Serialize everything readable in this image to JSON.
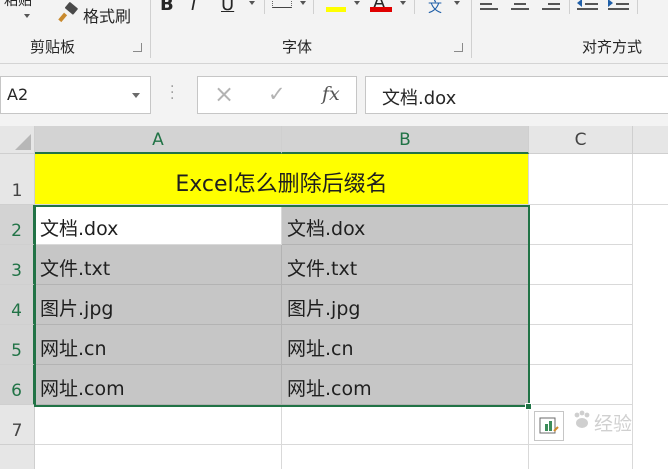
{
  "ribbon": {
    "groups": [
      {
        "label": "剪贴板"
      },
      {
        "label": "字体"
      },
      {
        "label": "对齐方式"
      }
    ],
    "format_painter_label": "格式刷",
    "paste_partial": "粘贴",
    "bold_label": "B",
    "italic_label": "I",
    "underline_label": "U",
    "font_color_letter": "A",
    "wen_label": "文",
    "colors": {
      "highlight": "#ffff00",
      "font_color": "#e00000",
      "accent": "#217346"
    }
  },
  "formula_bar": {
    "name_box": "A2",
    "cancel_icon": "×",
    "enter_icon": "✓",
    "fx_label": "fx",
    "value": "文档.dox"
  },
  "grid": {
    "columns": [
      "A",
      "B",
      "C"
    ],
    "rows": [
      "1",
      "2",
      "3",
      "4",
      "5",
      "6",
      "7"
    ],
    "title": "Excel怎么删除后缀名",
    "data": [
      [
        "文档.dox",
        "文档.dox"
      ],
      [
        "文件.txt",
        "文件.txt"
      ],
      [
        "图片.jpg",
        "图片.jpg"
      ],
      [
        "网址.cn",
        "网址.cn"
      ],
      [
        "网址.com",
        "网址.com"
      ]
    ],
    "colors": {
      "title_fill": "#ffff00",
      "selection_fill": "#c6c6c6",
      "selection_border": "#217346"
    }
  },
  "watermark": {
    "text": "经验"
  }
}
